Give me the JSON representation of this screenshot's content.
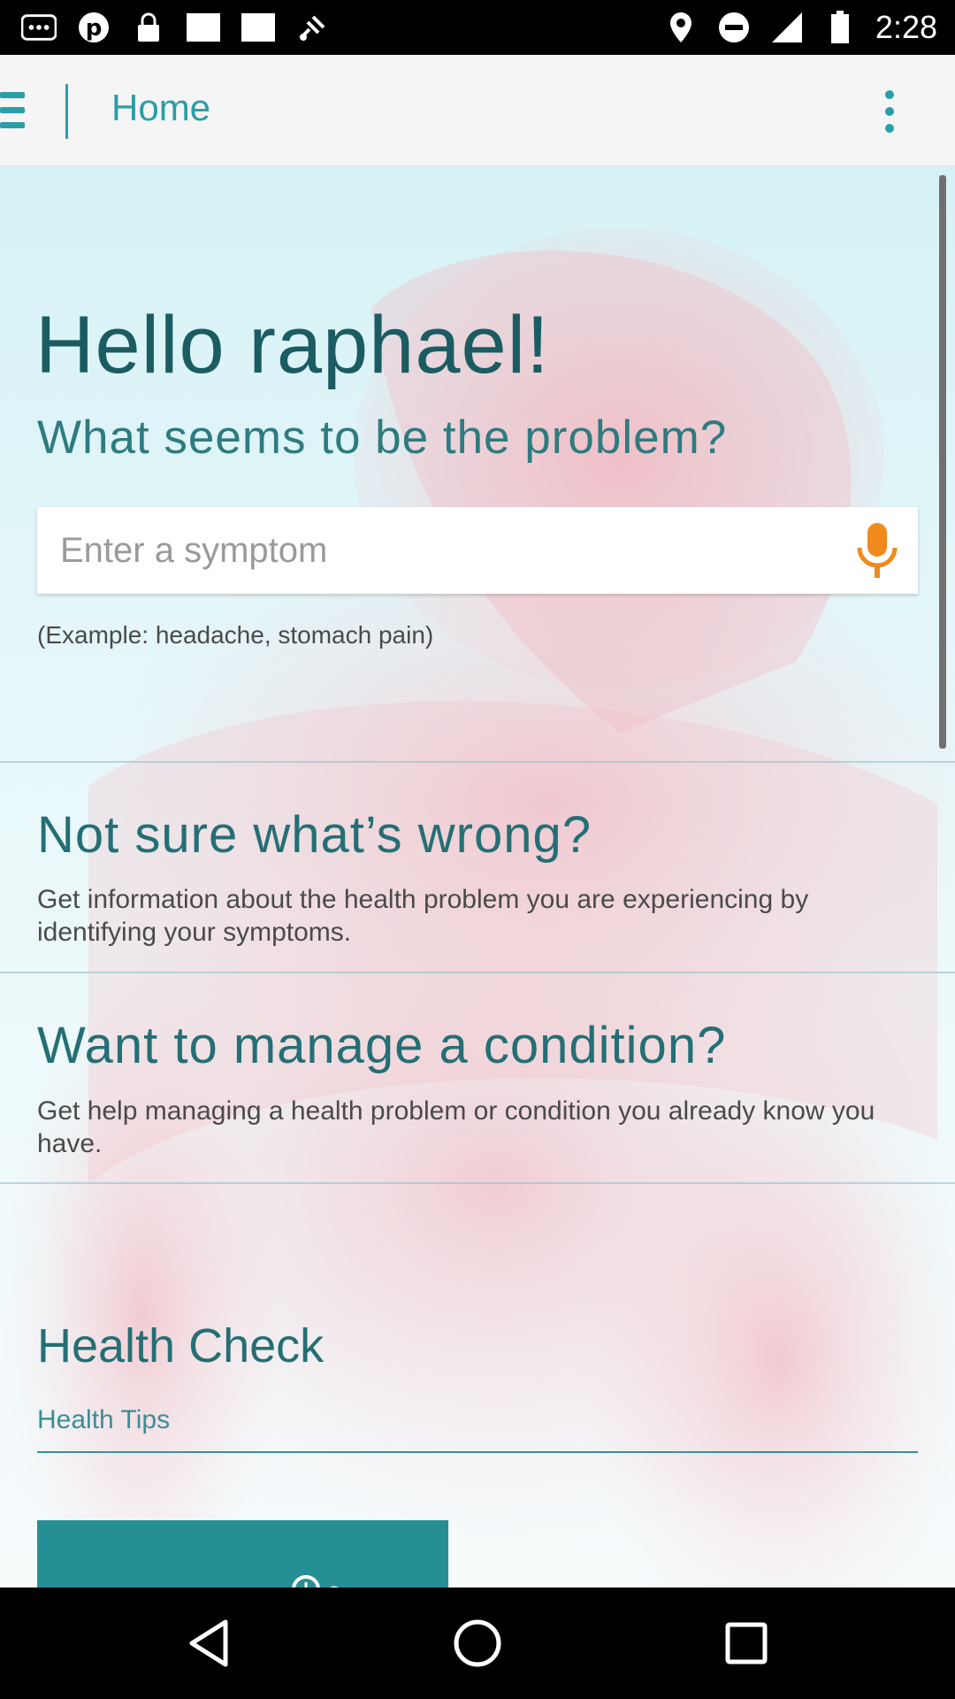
{
  "status_bar": {
    "time": "2:28",
    "left_icons": [
      "more-icon",
      "pinterest-icon",
      "lock-icon",
      "image-icon",
      "image-icon",
      "fake-gps-icon"
    ],
    "right_icons": [
      "location-icon",
      "do-not-disturb-icon",
      "signal-icon",
      "battery-icon"
    ]
  },
  "app_bar": {
    "title": "Home",
    "menu_icon": "hamburger-icon",
    "overflow_icon": "more-vert-icon"
  },
  "main": {
    "greeting": "Hello raphael!",
    "question": "What seems to be the problem?",
    "search": {
      "placeholder": "Enter a symptom",
      "value": "",
      "mic_icon": "microphone-icon"
    },
    "example": "(Example: headache, stomach pain)",
    "sections": [
      {
        "title": "Not sure what’s wrong?",
        "description": "Get information about the health problem you are experiencing by identifying your symptoms."
      },
      {
        "title": "Want to manage a condition?",
        "description": "Get help managing a health problem or condition you already know you have."
      }
    ],
    "health_check": {
      "title": "Health Check",
      "tab": "Health Tips"
    }
  },
  "colors": {
    "accent": "#2a9ea6",
    "heading": "#1b5c62",
    "mic": "#f08a1c",
    "card": "#268f95"
  },
  "nav_bar": {
    "icons": [
      "back-icon",
      "home-icon",
      "recents-icon"
    ]
  }
}
